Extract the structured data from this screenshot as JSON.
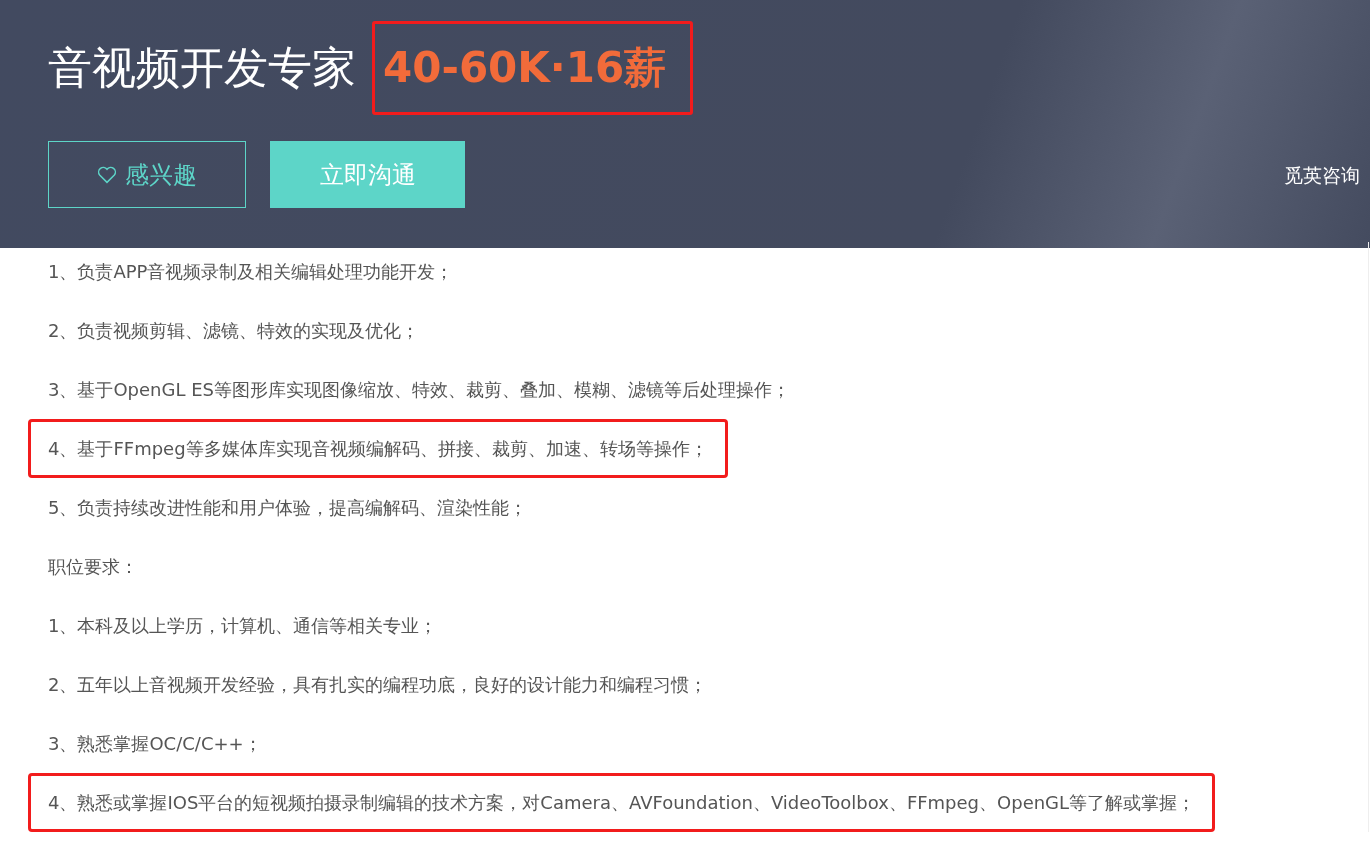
{
  "header": {
    "title": "音视频开发专家",
    "salary": "40-60K·16薪",
    "salary_highlighted": true,
    "buttons": [
      {
        "kind": "outline",
        "label": "感兴趣"
      },
      {
        "kind": "filled",
        "label": "立即沟通"
      }
    ],
    "consult": "觅英咨询"
  },
  "description": [
    {
      "text": "1、负责APP音视频录制及相关编辑处理功能开发；",
      "highlighted": false
    },
    {
      "text": "2、负责视频剪辑、滤镜、特效的实现及优化；",
      "highlighted": false
    },
    {
      "text": "3、基于OpenGL ES等图形库实现图像缩放、特效、裁剪、叠加、模糊、滤镜等后处理操作；",
      "highlighted": false
    },
    {
      "text": "4、基于FFmpeg等多媒体库实现音视频编解码、拼接、裁剪、加速、转场等操作；",
      "highlighted": true
    },
    {
      "text": "5、负责持续改进性能和用户体验，提高编解码、渲染性能；",
      "highlighted": false
    },
    {
      "text": "职位要求：",
      "highlighted": false
    },
    {
      "text": "1、本科及以上学历，计算机、通信等相关专业；",
      "highlighted": false
    },
    {
      "text": "2、五年以上音视频开发经验，具有扎实的编程功底，良好的设计能力和编程习惯；",
      "highlighted": false
    },
    {
      "text": "3、熟悉掌握OC/C/C++；",
      "highlighted": false
    },
    {
      "text": "4、熟悉或掌握IOS平台的短视频拍摄录制编辑的技术方案，对Camera、AVFoundation、VideoToolbox、FFmpeg、OpenGL等了解或掌握；",
      "highlighted": true
    }
  ]
}
